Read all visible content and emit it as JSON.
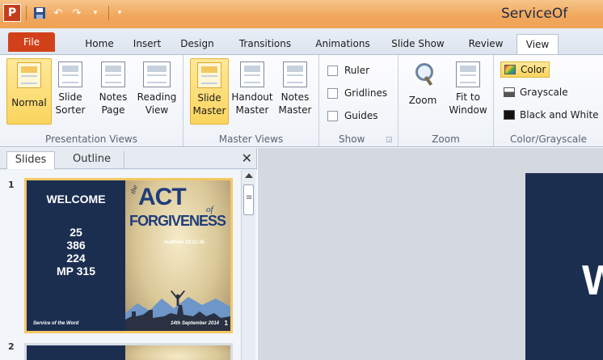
{
  "window": {
    "title_partial": "ServiceOf"
  },
  "qat": {
    "app_icon_letter": "P"
  },
  "tabs": [
    "File",
    "Home",
    "Insert",
    "Design",
    "Transitions",
    "Animations",
    "Slide Show",
    "Review",
    "View"
  ],
  "active_tab": "View",
  "ribbon": {
    "presentation_views": {
      "label": "Presentation Views",
      "buttons": [
        {
          "line1": "Normal",
          "line2": ""
        },
        {
          "line1": "Slide",
          "line2": "Sorter"
        },
        {
          "line1": "Notes",
          "line2": "Page"
        },
        {
          "line1": "Reading",
          "line2": "View"
        }
      ]
    },
    "master_views": {
      "label": "Master Views",
      "buttons": [
        {
          "line1": "Slide",
          "line2": "Master"
        },
        {
          "line1": "Handout",
          "line2": "Master"
        },
        {
          "line1": "Notes",
          "line2": "Master"
        }
      ]
    },
    "show": {
      "label": "Show",
      "options": [
        "Ruler",
        "Gridlines",
        "Guides"
      ]
    },
    "zoom": {
      "label": "Zoom",
      "buttons": [
        {
          "line1": "Zoom",
          "line2": ""
        },
        {
          "line1": "Fit to",
          "line2": "Window"
        }
      ]
    },
    "color_grayscale": {
      "label": "Color/Grayscale",
      "options": [
        "Color",
        "Grayscale",
        "Black and White"
      ]
    }
  },
  "left_pane": {
    "tabs": [
      "Slides",
      "Outline"
    ],
    "close_glyph": "✕",
    "slides": [
      {
        "number": "1",
        "welcome": "WELCOME",
        "hymns": [
          "25",
          "386",
          "224",
          "MP 315"
        ],
        "footer_left": "Service of the Word",
        "footer_right": "14th September 2014",
        "footer_number": "1",
        "art": {
          "the": "the",
          "act": "ACT",
          "of": "of",
          "forgiveness": "FORGIVENESS",
          "ref": "matthew 18:21-35"
        }
      },
      {
        "number": "2"
      }
    ]
  },
  "main": {
    "visible_letter": "W"
  },
  "colors": {
    "title_bar": "#f1a85d",
    "file_tab": "#d2401a",
    "active_highlight": "#fbd45e",
    "slide_bg": "#1c2e50"
  }
}
